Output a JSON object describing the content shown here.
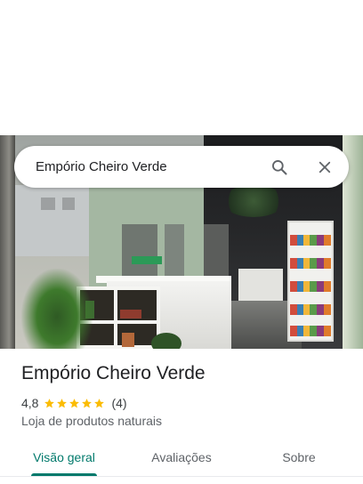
{
  "search": {
    "query": "Empório Cheiro Verde",
    "search_icon": "search-icon",
    "close_icon": "close-icon"
  },
  "place": {
    "name": "Empório Cheiro Verde",
    "rating": "4,8",
    "rating_value": 4.8,
    "stars_filled": 5,
    "review_count": "(4)",
    "category": "Loja de produtos naturais"
  },
  "tabs": [
    {
      "label": "Visão geral",
      "active": true
    },
    {
      "label": "Avaliações",
      "active": false
    },
    {
      "label": "Sobre",
      "active": false
    }
  ],
  "colors": {
    "accent": "#00796b",
    "star": "#fbbc04",
    "text_primary": "#202124",
    "text_secondary": "#5f6368"
  }
}
